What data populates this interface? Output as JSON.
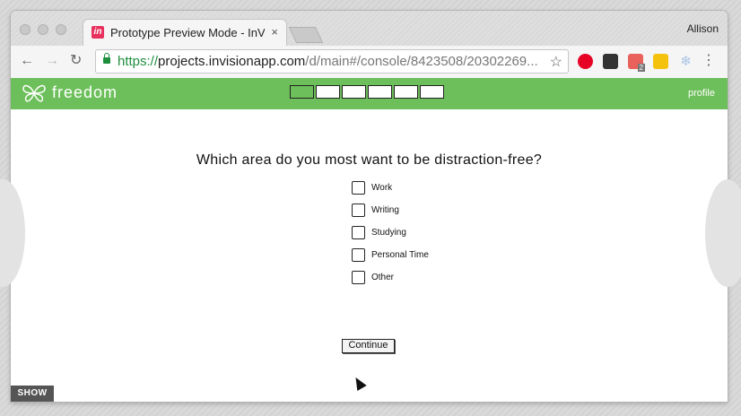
{
  "browser": {
    "tab_title": "Prototype Preview Mode - InVision",
    "tab_favicon": "in",
    "tab_close": "×",
    "profile_name": "Allison",
    "url_scheme": "https://",
    "url_host": "projects.invisionapp.com",
    "url_path": "/d/main#/console/8423508/20302269...",
    "extensions": [
      {
        "name": "pinterest-icon",
        "color": "#e60023"
      },
      {
        "name": "buffer-icon",
        "color": "#333333"
      },
      {
        "name": "mail-icon",
        "color": "#e8615a",
        "badge": "2"
      },
      {
        "name": "notes-icon",
        "color": "#f4c20d"
      },
      {
        "name": "snowflake-icon",
        "color": "#aac4e6"
      }
    ]
  },
  "app": {
    "brand": "freedom",
    "profile_link": "profile",
    "progress": {
      "total_steps": 6,
      "completed_steps": 1
    },
    "question": "Which area do you most want to be distraction-free?",
    "options": [
      "Work",
      "Writing",
      "Studying",
      "Personal Time",
      "Other"
    ],
    "continue_label": "Continue",
    "accent_color": "#6cbf5a"
  },
  "overlay": {
    "show_label": "SHOW"
  }
}
